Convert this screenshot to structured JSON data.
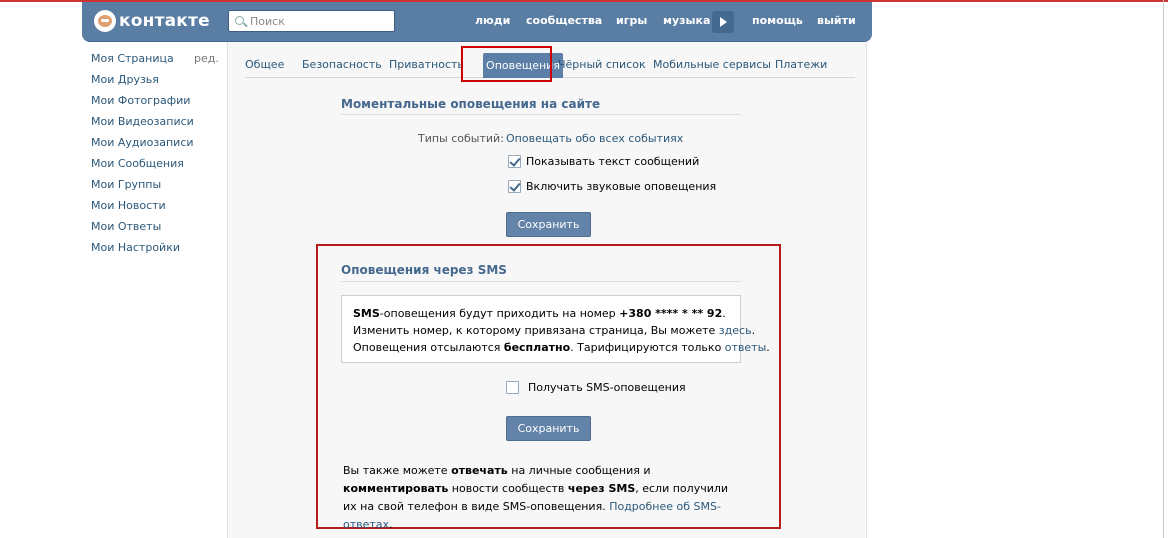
{
  "header": {
    "logo_text": "контакте",
    "search_placeholder": "Поиск",
    "nav": [
      "люди",
      "сообщества",
      "игры",
      "музыка",
      "помощь",
      "выйти"
    ]
  },
  "sidebar": {
    "edit_label": "ред.",
    "items": [
      "Моя Страница",
      "Мои Друзья",
      "Мои Фотографии",
      "Мои Видеозаписи",
      "Мои Аудиозаписи",
      "Мои Сообщения",
      "Мои Группы",
      "Мои Новости",
      "Мои Ответы",
      "Мои Настройки"
    ]
  },
  "tabs": {
    "items": [
      "Общее",
      "Безопасность",
      "Приватность",
      "Оповещения",
      "Чёрный список",
      "Мобильные сервисы",
      "Платежи"
    ],
    "active": "Оповещения"
  },
  "instant": {
    "title": "Моментальные оповещения на сайте",
    "event_types_label": "Типы событий:",
    "event_types_value": "Оповещать обо всех событиях",
    "show_text_label": "Показывать текст сообщений",
    "sound_label": "Включить звуковые оповещения",
    "save_label": "Сохранить"
  },
  "sms": {
    "title": "Оповещения через SMS",
    "info_line1_bold1": "SMS",
    "info_line1_text": "-оповещения будут приходить на номер ",
    "info_line1_number": "+380 **** * ** 92",
    "info_line1_end": ".",
    "info_line2_text": "Изменить номер, к которому привязана страница, Вы можете ",
    "info_line2_link": "здесь",
    "info_line2_end": ".",
    "info_line3_text": "Оповещения отсылаются ",
    "info_line3_bold": "бесплатно",
    "info_line3_mid": ". Тарифицируются только ",
    "info_line3_link": "ответы",
    "info_line3_end": ".",
    "receive_label": "Получать SMS-оповещения",
    "save_label": "Сохранить",
    "bottom_1": "Вы также можете ",
    "bottom_bold1": "отвечать",
    "bottom_2": " на личные сообщения и ",
    "bottom_bold2": "комментировать",
    "bottom_3": " новости сообществ ",
    "bottom_bold3": "через SMS",
    "bottom_4": ", если получили их на свой телефон в виде SMS-оповещения. ",
    "bottom_link": "Подробнее об SMS-ответах",
    "bottom_end": "."
  }
}
